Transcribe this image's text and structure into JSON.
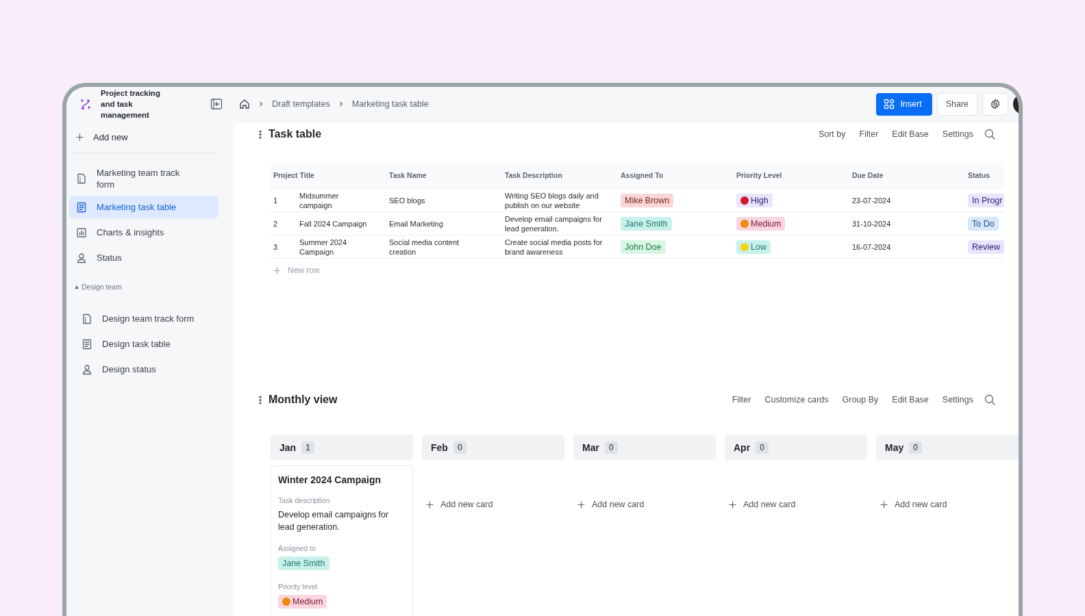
{
  "app": {
    "title": "Project tracking and task management"
  },
  "sidebar": {
    "add_label": "Add new",
    "items": [
      {
        "label": "Marketing team track form",
        "kind": "form",
        "selected": false
      },
      {
        "label": "Marketing task table",
        "kind": "table",
        "selected": true
      },
      {
        "label": "Charts & insights",
        "kind": "chart",
        "selected": false
      },
      {
        "label": "Status",
        "kind": "person",
        "selected": false
      }
    ],
    "groups": [
      {
        "label": "Design team",
        "expanded": true,
        "items": [
          {
            "label": "Design team track form",
            "kind": "form",
            "selected": false
          },
          {
            "label": "Design task table",
            "kind": "table",
            "selected": false
          },
          {
            "label": "Design status",
            "kind": "person",
            "selected": false
          }
        ]
      }
    ]
  },
  "breadcrumbs": [
    "Draft templates",
    "Marketing task table"
  ],
  "actions": {
    "insert": "Insert",
    "share": "Share"
  },
  "task_table": {
    "title": "Task table",
    "tools": [
      "Sort by",
      "Filter",
      "Edit Base",
      "Settings"
    ],
    "columns": [
      "Project Title",
      "Task Name",
      "Task Description",
      "Assigned To",
      "Priority Level",
      "Due Date",
      "Status"
    ],
    "rows": [
      {
        "number": "1",
        "project": "Midsummer campaign",
        "task": "SEO blogs",
        "description": "Writing SEO blogs daily and publish on our website",
        "assigned": {
          "text": "Mike Brown",
          "color": "#fbd6d6"
        },
        "priority": {
          "text": "High",
          "color": "#e9e5fd",
          "dot": {
            "color": "#d0142a"
          }
        },
        "due": "23-07-2024",
        "status": {
          "text": "In Progr",
          "color": "#e7e4fb"
        }
      },
      {
        "number": "2",
        "project": "Fall 2024 Campaign",
        "task": "Email Marketing",
        "description": "Develop email campaigns for lead generation.",
        "assigned": {
          "text": "Jane Smith",
          "color": "#c9f1ec"
        },
        "priority": {
          "text": "Medium",
          "color": "#fbd5df",
          "dot": {
            "color": "#f08a0c"
          }
        },
        "due": "31-10-2024",
        "status": {
          "text": "To Do",
          "color": "#d5e9fb"
        }
      },
      {
        "number": "3",
        "project": "Summer 2024 Campaign",
        "task": "Social media content creation",
        "description": "Create social media posts for brand awareness",
        "assigned": {
          "text": "John Doe",
          "color": "#d8f6e3"
        },
        "priority": {
          "text": "Low",
          "color": "#c9f1ec",
          "dot": {
            "color": "#f7d418"
          }
        },
        "due": "16-07-2024",
        "status": {
          "text": "Review",
          "color": "#e7e4fb"
        }
      }
    ],
    "new_row": "New row"
  },
  "monthly_view": {
    "title": "Monthly view",
    "tools": [
      "Filter",
      "Customize cards",
      "Group By",
      "Edit Base",
      "Settings"
    ],
    "months": [
      {
        "name": "Jan",
        "count": "1",
        "cards": [
          {
            "title": "Winter 2024 Campaign",
            "fields": [
              {
                "label": "Task description",
                "kind": "text",
                "value": "Develop email campaigns for lead generation."
              },
              {
                "label": "Assigned to",
                "kind": "tag",
                "tag": {
                  "text": "Jane Smith",
                  "color": "#c9f1ec"
                }
              },
              {
                "label": "Priority level",
                "kind": "priority",
                "tag": {
                  "text": "Medium",
                  "color": "#fbd5df",
                  "dot": {
                    "color": "#f08a0c"
                  }
                }
              }
            ]
          }
        ]
      },
      {
        "name": "Feb",
        "count": "0",
        "add_label": "Add new card"
      },
      {
        "name": "Mar",
        "count": "0",
        "add_label": "Add new card"
      },
      {
        "name": "Apr",
        "count": "0",
        "add_label": "Add new card"
      },
      {
        "name": "May",
        "count": "0",
        "add_label": "Add new card"
      }
    ]
  }
}
